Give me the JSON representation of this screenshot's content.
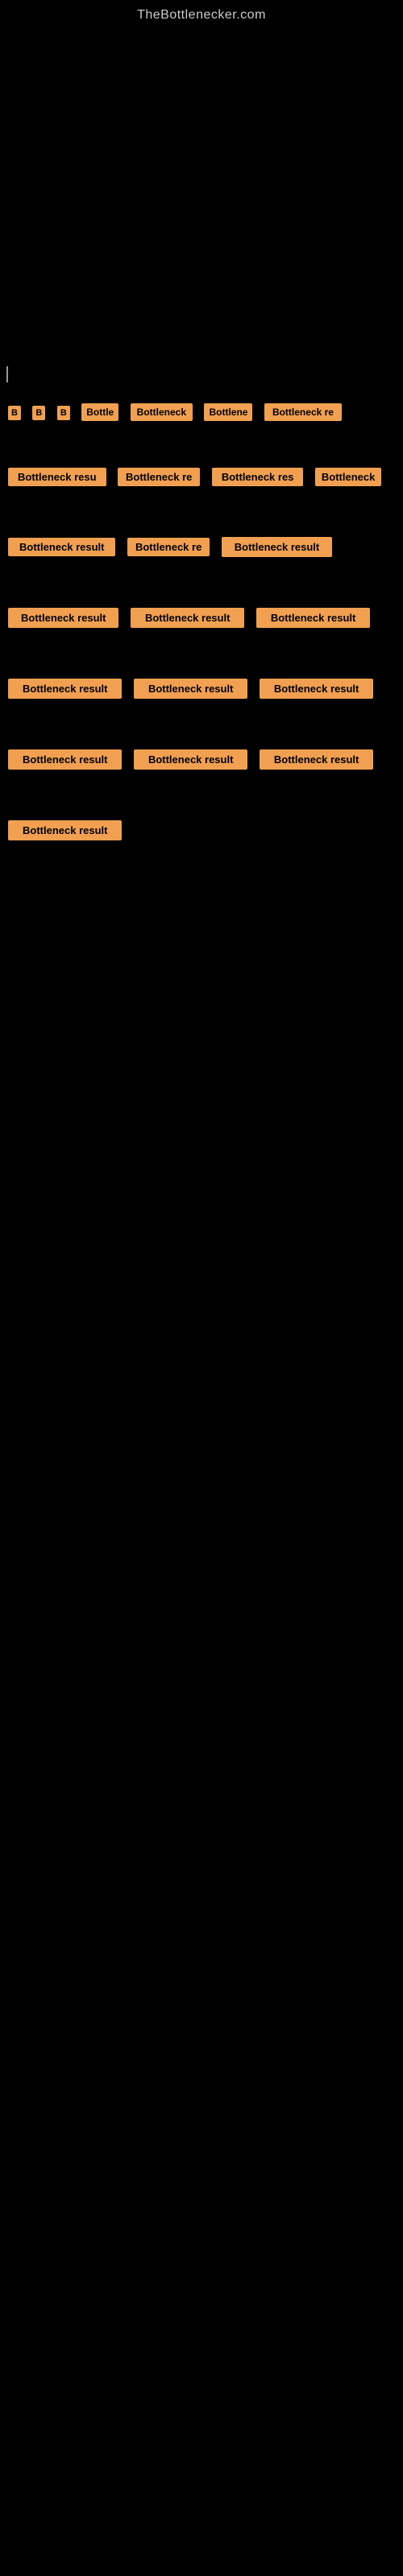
{
  "site": {
    "title": "TheBottlenecker.com"
  },
  "items": [
    {
      "id": 1,
      "label": "B",
      "class": "item-1"
    },
    {
      "id": 2,
      "label": "B",
      "class": "item-2"
    },
    {
      "id": 3,
      "label": "B",
      "class": "item-3"
    },
    {
      "id": 4,
      "label": "Bottle",
      "class": "item-4"
    },
    {
      "id": 5,
      "label": "Bottleneck",
      "class": "item-5"
    },
    {
      "id": 6,
      "label": "Bottlene",
      "class": "item-6"
    },
    {
      "id": 7,
      "label": "Bottleneck re",
      "class": "item-7"
    },
    {
      "id": 8,
      "label": "Bottleneck resu",
      "class": "item-8"
    },
    {
      "id": 9,
      "label": "Bottleneck re",
      "class": "item-9"
    },
    {
      "id": 10,
      "label": "Bottleneck res",
      "class": "item-10"
    },
    {
      "id": 11,
      "label": "Bottleneck",
      "class": "item-11"
    },
    {
      "id": 12,
      "label": "Bottleneck result",
      "class": "item-12"
    },
    {
      "id": 13,
      "label": "Bottleneck re",
      "class": "item-13"
    },
    {
      "id": 14,
      "label": "Bottleneck result",
      "class": "item-14"
    },
    {
      "id": 15,
      "label": "Bottleneck result",
      "class": "item-15"
    },
    {
      "id": 16,
      "label": "Bottleneck result",
      "class": "item-16"
    },
    {
      "id": 17,
      "label": "Bottleneck result",
      "class": "item-17"
    },
    {
      "id": 18,
      "label": "Bottleneck result",
      "class": "item-18"
    },
    {
      "id": 19,
      "label": "Bottleneck result",
      "class": "item-19"
    },
    {
      "id": 20,
      "label": "Bottleneck result",
      "class": "item-20"
    },
    {
      "id": 21,
      "label": "Bottleneck result",
      "class": "item-21"
    },
    {
      "id": 22,
      "label": "Bottleneck result",
      "class": "item-22"
    },
    {
      "id": 23,
      "label": "Bottleneck result",
      "class": "item-23"
    },
    {
      "id": 24,
      "label": "Bottleneck result",
      "class": "item-24"
    }
  ]
}
